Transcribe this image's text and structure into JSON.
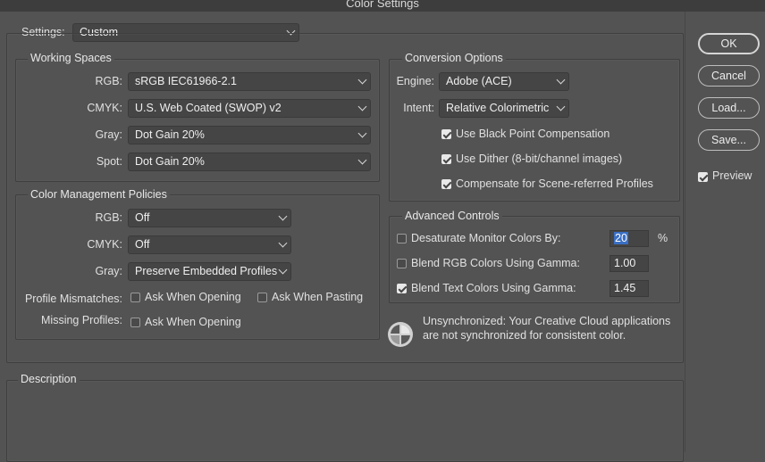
{
  "window": {
    "title": "Color Settings"
  },
  "settings": {
    "label": "Settings:",
    "value": "Custom"
  },
  "working_spaces": {
    "title": "Working Spaces",
    "rgb": {
      "label": "RGB:",
      "value": "sRGB IEC61966-2.1"
    },
    "cmyk": {
      "label": "CMYK:",
      "value": "U.S. Web Coated (SWOP) v2"
    },
    "gray": {
      "label": "Gray:",
      "value": "Dot Gain 20%"
    },
    "spot": {
      "label": "Spot:",
      "value": "Dot Gain 20%"
    }
  },
  "policies": {
    "title": "Color Management Policies",
    "rgb": {
      "label": "RGB:",
      "value": "Off"
    },
    "cmyk": {
      "label": "CMYK:",
      "value": "Off"
    },
    "gray": {
      "label": "Gray:",
      "value": "Preserve Embedded Profiles"
    },
    "mismatch_label": "Profile Mismatches:",
    "ask_opening": {
      "label": "Ask When Opening",
      "checked": false
    },
    "ask_pasting": {
      "label": "Ask When Pasting",
      "checked": false
    },
    "missing_label": "Missing Profiles:",
    "missing_ask_opening": {
      "label": "Ask When Opening",
      "checked": false
    }
  },
  "conversion": {
    "title": "Conversion Options",
    "engine": {
      "label": "Engine:",
      "value": "Adobe (ACE)"
    },
    "intent": {
      "label": "Intent:",
      "value": "Relative Colorimetric"
    },
    "black_point": {
      "label": "Use Black Point Compensation",
      "checked": true
    },
    "dither": {
      "label": "Use Dither (8-bit/channel images)",
      "checked": true
    },
    "scene": {
      "label": "Compensate for Scene-referred Profiles",
      "checked": true
    }
  },
  "advanced": {
    "title": "Advanced Controls",
    "desaturate": {
      "label": "Desaturate Monitor Colors By:",
      "value": "20",
      "unit": "%",
      "checked": false
    },
    "blend_rgb": {
      "label": "Blend RGB Colors Using Gamma:",
      "value": "1.00",
      "checked": false
    },
    "blend_text": {
      "label": "Blend Text Colors Using Gamma:",
      "value": "1.45",
      "checked": true
    }
  },
  "sync": {
    "icon": "sync-status-icon",
    "message": "Unsynchronized: Your Creative Cloud applications are not synchronized for consistent color."
  },
  "description": {
    "title": "Description"
  },
  "buttons": {
    "ok": "OK",
    "cancel": "Cancel",
    "load": "Load...",
    "save": "Save..."
  },
  "preview": {
    "label": "Preview",
    "checked": true
  }
}
